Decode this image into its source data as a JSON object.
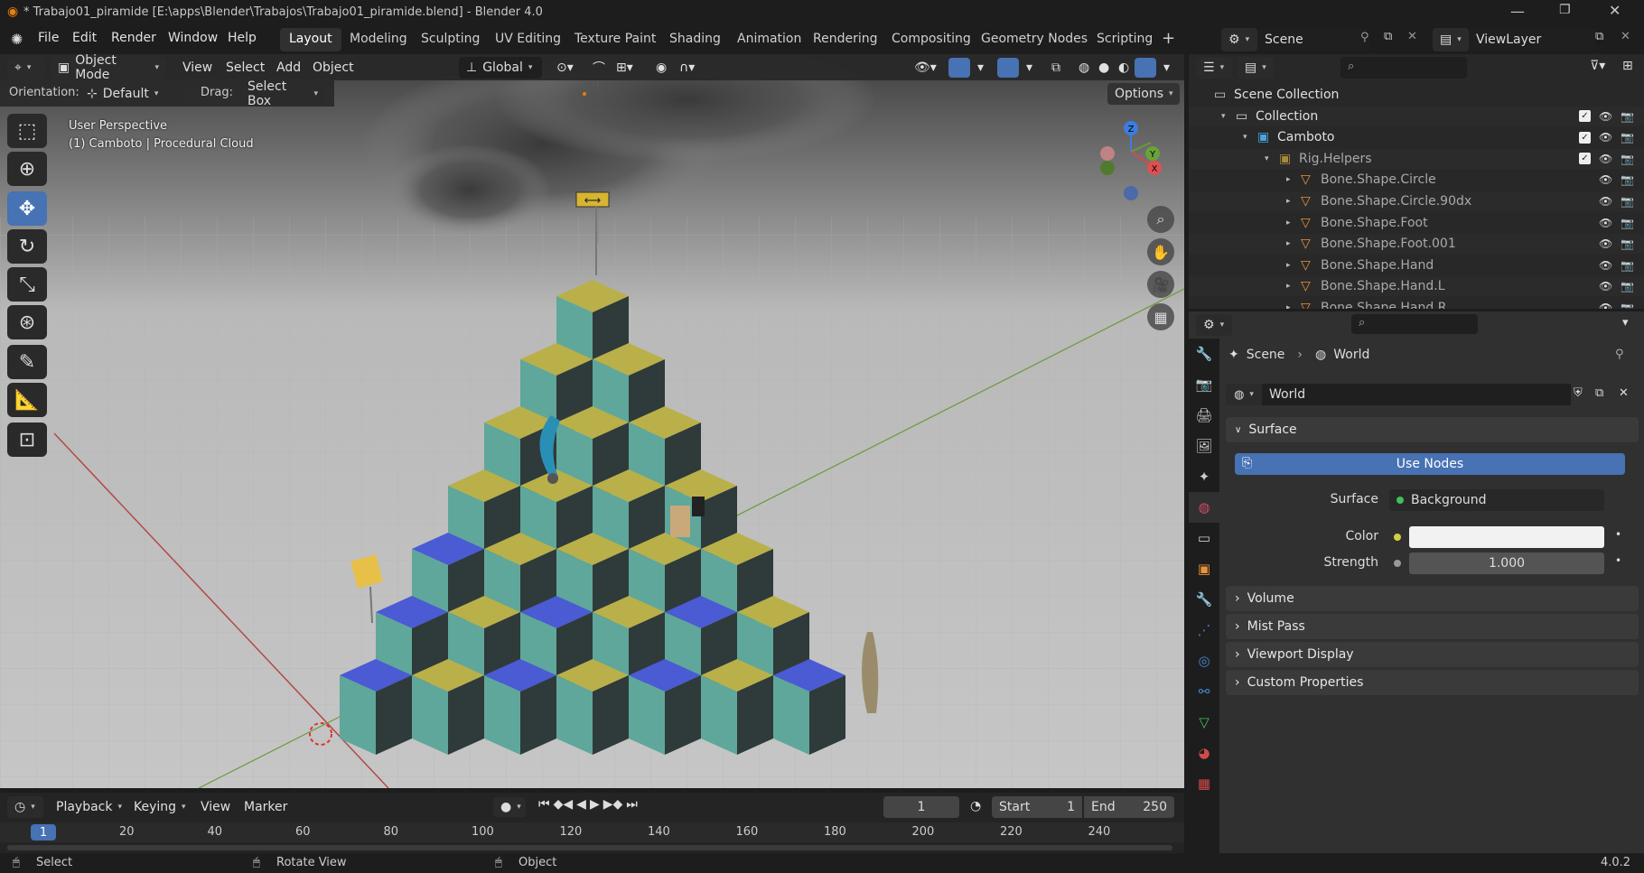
{
  "window": {
    "title": "* Trabajo01_piramide [E:\\apps\\Blender\\Trabajos\\Trabajo01_piramide.blend] - Blender 4.0"
  },
  "menus": [
    "File",
    "Edit",
    "Render",
    "Window",
    "Help"
  ],
  "workspaces": [
    "Layout",
    "Modeling",
    "Sculpting",
    "UV Editing",
    "Texture Paint",
    "Shading",
    "Animation",
    "Rendering",
    "Compositing",
    "Geometry Nodes",
    "Scripting"
  ],
  "active_workspace": "Layout",
  "scene_name": "Scene",
  "view_layer": "ViewLayer",
  "viewport": {
    "mode": "Object Mode",
    "menus": [
      "View",
      "Select",
      "Add",
      "Object"
    ],
    "transform_orientation": "Global",
    "orientation_label": "Orientation:",
    "orientation_value": "Default",
    "drag_label": "Drag:",
    "drag_value": "Select Box",
    "options": "Options",
    "overlay_line1": "User Perspective",
    "overlay_line2": "(1) Camboto | Procedural Cloud",
    "gizmo": {
      "x": "X",
      "y": "Y",
      "z": "Z"
    }
  },
  "timeline": {
    "menus": [
      "Playback",
      "Keying",
      "View",
      "Marker"
    ],
    "current_frame": "1",
    "start_label": "Start",
    "start": "1",
    "end_label": "End",
    "end": "250",
    "ruler": [
      "20",
      "40",
      "60",
      "80",
      "100",
      "120",
      "140",
      "160",
      "180",
      "200",
      "220",
      "240"
    ],
    "cursor_frame": "1"
  },
  "status": {
    "select": "Select",
    "rotate": "Rotate View",
    "object": "Object",
    "version": "4.0.2"
  },
  "outliner": {
    "items": [
      {
        "label": "Scene Collection",
        "depth": 0,
        "type": "collection-root"
      },
      {
        "label": "Collection",
        "depth": 1,
        "type": "collection"
      },
      {
        "label": "Camboto",
        "depth": 2,
        "type": "collection-blue"
      },
      {
        "label": "Rig.Helpers",
        "depth": 3,
        "type": "collection-dim"
      },
      {
        "label": "Bone.Shape.Circle",
        "depth": 4,
        "type": "mesh"
      },
      {
        "label": "Bone.Shape.Circle.90dx",
        "depth": 4,
        "type": "mesh"
      },
      {
        "label": "Bone.Shape.Foot",
        "depth": 4,
        "type": "mesh"
      },
      {
        "label": "Bone.Shape.Foot.001",
        "depth": 4,
        "type": "mesh"
      },
      {
        "label": "Bone.Shape.Hand",
        "depth": 4,
        "type": "mesh"
      },
      {
        "label": "Bone.Shape.Hand.L",
        "depth": 4,
        "type": "mesh"
      },
      {
        "label": "Bone.Shape.Hand.R",
        "depth": 4,
        "type": "mesh"
      }
    ]
  },
  "properties": {
    "breadcrumb": [
      "Scene",
      "World"
    ],
    "datablock": "World",
    "surface_panel": "Surface",
    "use_nodes": "Use Nodes",
    "surface_label": "Surface",
    "surface_value": "Background",
    "color_label": "Color",
    "strength_label": "Strength",
    "strength_value": "1.000",
    "collapsed_panels": [
      "Volume",
      "Mist Pass",
      "Viewport Display",
      "Custom Properties"
    ]
  },
  "colors": {
    "accent": "#4772b3",
    "cube_top_yellow": "#b9b04a",
    "cube_top_blue": "#4a5bd4",
    "cube_side_teal": "#5fa79a",
    "cube_side_dark": "#2f3a3a"
  }
}
